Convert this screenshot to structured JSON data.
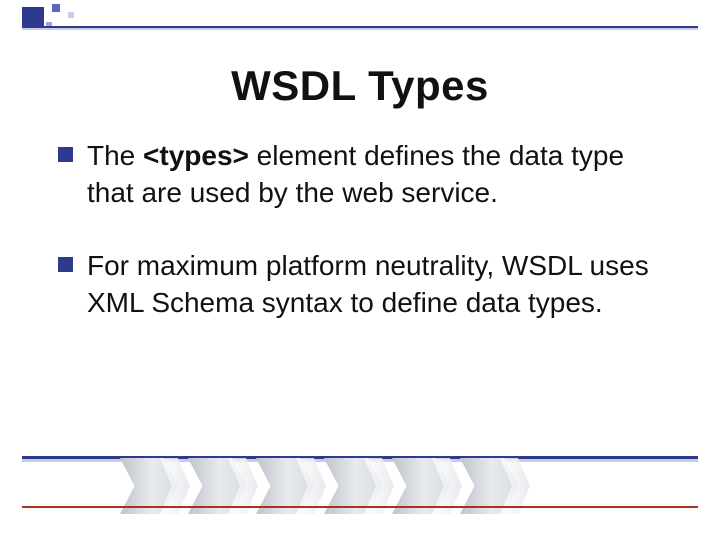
{
  "title": "WSDL Types",
  "bullets": [
    {
      "pre": "The ",
      "strong": "<types>",
      "post": " element defines the data type that are used by the web service."
    },
    {
      "pre": "For maximum platform neutrality, WSDL uses XML Schema syntax to define data types.",
      "strong": "",
      "post": ""
    }
  ],
  "chevron_count": 6
}
